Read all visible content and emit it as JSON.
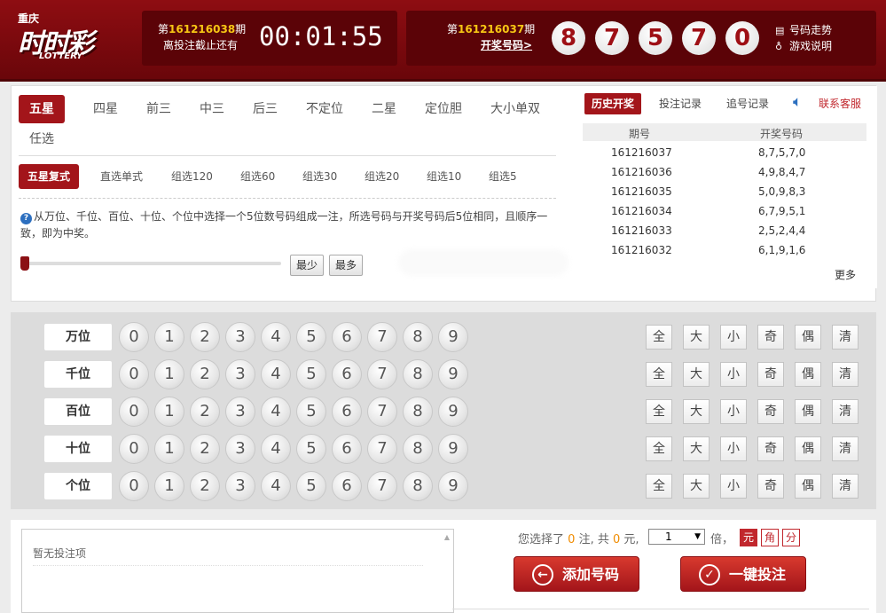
{
  "header": {
    "logo_city": "重庆",
    "logo_main": "时时彩",
    "logo_en": "LOTTERY",
    "current": {
      "prefix": "第",
      "issue": "161216038",
      "suffix": "期",
      "deadline_label": "离投注截止还有",
      "countdown": "00:01:55"
    },
    "last": {
      "prefix": "第",
      "issue": "161216037",
      "suffix": "期",
      "link": "开奖号码>",
      "numbers": [
        "8",
        "7",
        "5",
        "7",
        "0"
      ]
    },
    "links": [
      {
        "label": "号码走势",
        "icon": "chart-icon"
      },
      {
        "label": "游戏说明",
        "icon": "bulb-icon"
      }
    ]
  },
  "play_tabs": [
    "五星",
    "四星",
    "前三",
    "中三",
    "后三",
    "不定位",
    "二星",
    "定位胆",
    "大小单双",
    "任选"
  ],
  "sub_tabs": [
    "五星复式",
    "直选单式",
    "组选120",
    "组选60",
    "组选30",
    "组选20",
    "组选10",
    "组选5"
  ],
  "description": "从万位、千位、百位、十位、个位中选择一个5位数号码组成一注，所选号码与开奖号码后5位相同，且顺序一致，即为中奖。",
  "slider": {
    "min_label": "最少",
    "max_label": "最多"
  },
  "history": {
    "tabs": [
      "历史开奖",
      "投注记录",
      "追号记录"
    ],
    "service": "联系客服",
    "columns": [
      "期号",
      "开奖号码"
    ],
    "rows": [
      {
        "issue": "161216037",
        "numbers": "8,7,5,7,0"
      },
      {
        "issue": "161216036",
        "numbers": "4,9,8,4,7"
      },
      {
        "issue": "161216035",
        "numbers": "5,0,9,8,3"
      },
      {
        "issue": "161216034",
        "numbers": "6,7,9,5,1"
      },
      {
        "issue": "161216033",
        "numbers": "2,5,2,4,4"
      },
      {
        "issue": "161216032",
        "numbers": "6,1,9,1,6"
      }
    ],
    "more": "更多"
  },
  "positions": [
    "万位",
    "千位",
    "百位",
    "十位",
    "个位"
  ],
  "digits": [
    "0",
    "1",
    "2",
    "3",
    "4",
    "5",
    "6",
    "7",
    "8",
    "9"
  ],
  "quick_buttons": [
    "全",
    "大",
    "小",
    "奇",
    "偶",
    "清"
  ],
  "betlist": {
    "empty": "暂无投注项"
  },
  "summary": {
    "p1": "您选择了",
    "count": "0",
    "p2": "注, 共",
    "amount": "0",
    "p3": "元,",
    "multiple": "1",
    "bei": "倍，"
  },
  "units": [
    "元",
    "角",
    "分"
  ],
  "actions": {
    "add": "添加号码",
    "bet": "一键投注"
  }
}
